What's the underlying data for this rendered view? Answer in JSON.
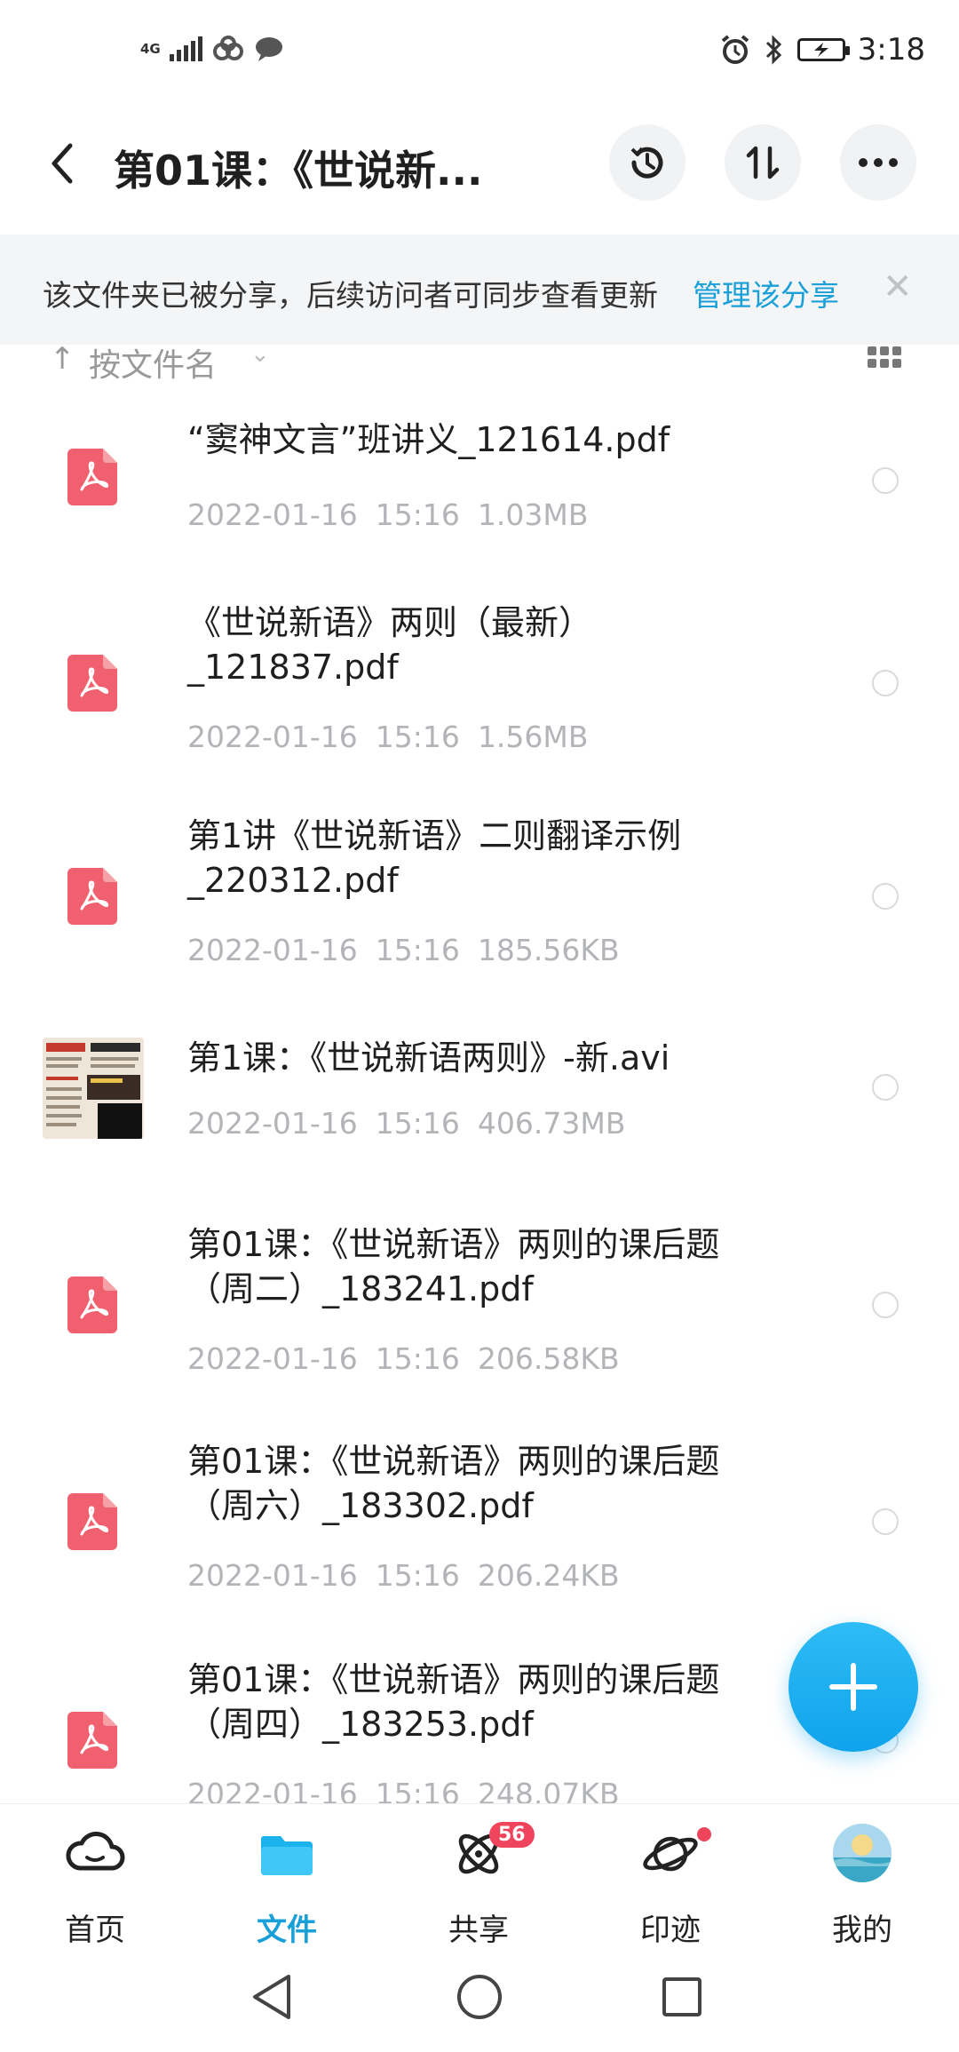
{
  "status_bar": {
    "network": "4G",
    "time": "3:18"
  },
  "header": {
    "title": "第01课：《世说新...",
    "history_icon": "history-icon",
    "sort_icon": "swap-vertical-icon",
    "more_icon": "more-horizontal-icon"
  },
  "share_banner": {
    "text": "该文件夹已被分享，后续访问者可同步查看更新",
    "link": "管理该分享",
    "close": "✕"
  },
  "sort": {
    "arrow": "↑",
    "label": "按文件名",
    "chevron": "⌄"
  },
  "files": [
    {
      "name": "“窦神文言”班讲义_121614.pdf",
      "date": "2022-01-16",
      "time": "15:16",
      "size": "1.03MB",
      "type": "pdf"
    },
    {
      "name": "《世说新语》两则（最新）\n_121837.pdf",
      "date": "2022-01-16",
      "time": "15:16",
      "size": "1.56MB",
      "type": "pdf"
    },
    {
      "name": "第1讲《世说新语》二则翻译示例\n_220312.pdf",
      "date": "2022-01-16",
      "time": "15:16",
      "size": "185.56KB",
      "type": "pdf"
    },
    {
      "name": "第1课：《世说新语两则》-新.avi",
      "date": "2022-01-16",
      "time": "15:16",
      "size": "406.73MB",
      "type": "video"
    },
    {
      "name": "第01课：《世说新语》两则的课后题\n（周二）_183241.pdf",
      "date": "2022-01-16",
      "time": "15:16",
      "size": "206.58KB",
      "type": "pdf"
    },
    {
      "name": "第01课：《世说新语》两则的课后题\n（周六）_183302.pdf",
      "date": "2022-01-16",
      "time": "15:16",
      "size": "206.24KB",
      "type": "pdf"
    },
    {
      "name": "第01课：《世说新语》两则的课后题\n（周四）_183253.pdf",
      "date": "2022-01-16",
      "time": "15:16",
      "size": "248.07KB",
      "type": "pdf"
    }
  ],
  "fab_icon": "plus-icon",
  "bottom_nav": [
    {
      "label": "首页",
      "icon": "cloud-icon"
    },
    {
      "label": "文件",
      "icon": "folder-icon",
      "active": true
    },
    {
      "label": "共享",
      "icon": "atom-icon",
      "badge": "56"
    },
    {
      "label": "印迹",
      "icon": "planet-icon",
      "dot": true
    },
    {
      "label": "我的",
      "icon": "avatar-icon"
    }
  ],
  "colors": {
    "accent": "#1aa0d8",
    "pdf": "#f0606e",
    "badge": "#f0445c"
  }
}
